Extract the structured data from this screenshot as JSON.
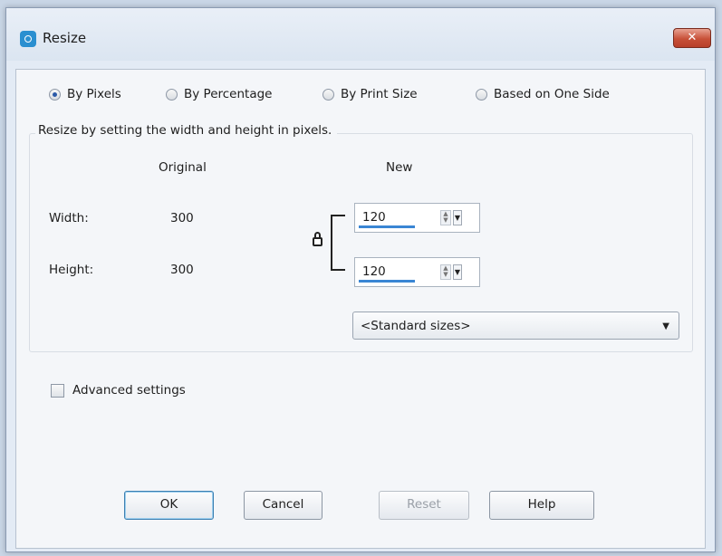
{
  "window": {
    "title": "Resize",
    "close_glyph": "✕",
    "app_icon": "app-logo-icon"
  },
  "mode": {
    "options": [
      {
        "label": "By Pixels",
        "selected": true
      },
      {
        "label": "By Percentage",
        "selected": false
      },
      {
        "label": "By Print Size",
        "selected": false
      },
      {
        "label": "Based on One Side",
        "selected": false
      }
    ]
  },
  "group": {
    "title": "Resize by setting the width and height in pixels.",
    "col_original": "Original",
    "col_new": "New",
    "width_label": "Width:",
    "height_label": "Height:",
    "original_width": "300",
    "original_height": "300",
    "new_width": "120",
    "new_height": "120",
    "standard_sizes": "<Standard sizes>"
  },
  "advanced": {
    "label": "Advanced settings",
    "checked": false
  },
  "buttons": {
    "ok": "OK",
    "cancel": "Cancel",
    "reset": "Reset",
    "help": "Help"
  },
  "colors": {
    "accent": "#3a86d4",
    "close": "#c75038"
  }
}
